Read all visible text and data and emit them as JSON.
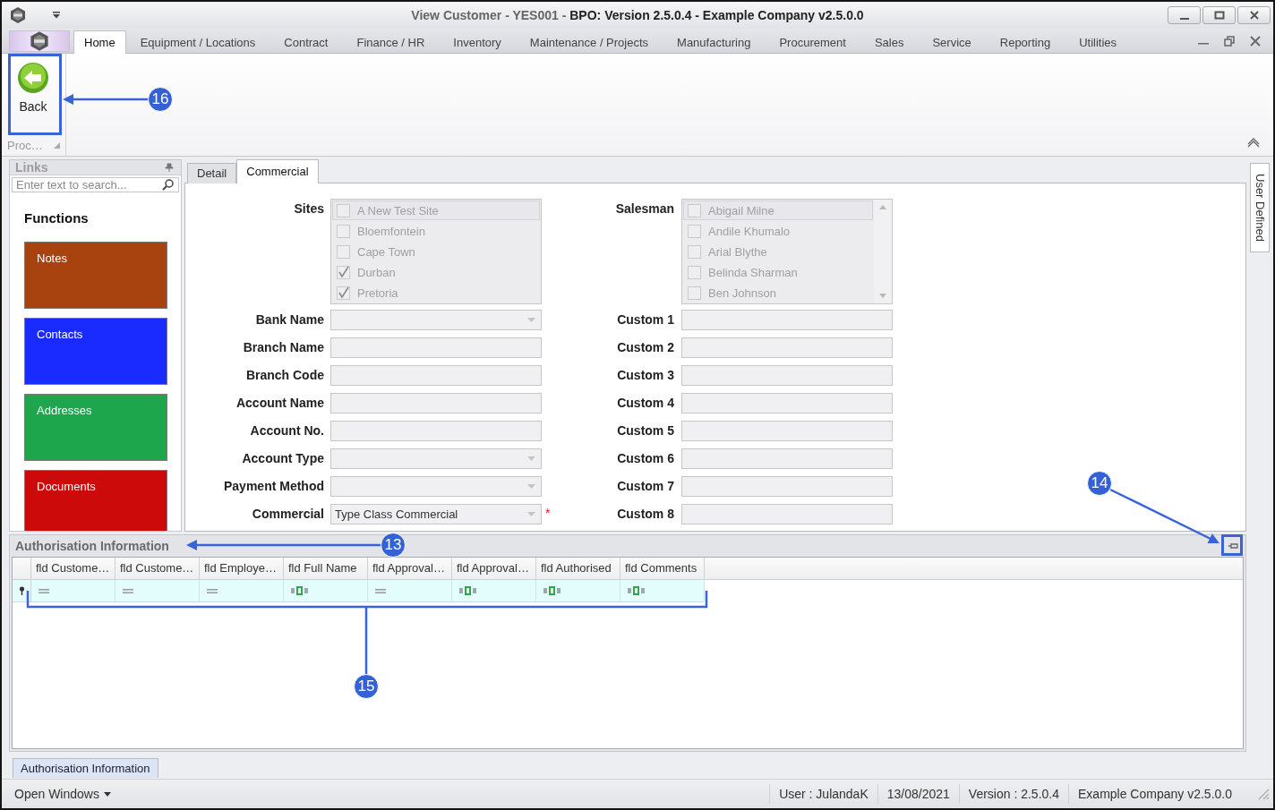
{
  "window": {
    "title": "View Customer - YES001 - **BPO: Version 2.5.0.4 - Example Company v2.5.0.0**"
  },
  "ribbon": {
    "tabs": [
      {
        "label": "Home",
        "selected": true
      },
      {
        "label": "Equipment / Locations",
        "selected": false
      },
      {
        "label": "Contract",
        "selected": false
      },
      {
        "label": "Finance / HR",
        "selected": false
      },
      {
        "label": "Inventory",
        "selected": false
      },
      {
        "label": "Maintenance / Projects",
        "selected": false
      },
      {
        "label": "Manufacturing",
        "selected": false
      },
      {
        "label": "Procurement",
        "selected": false
      },
      {
        "label": "Sales",
        "selected": false
      },
      {
        "label": "Service",
        "selected": false
      },
      {
        "label": "Reporting",
        "selected": false
      },
      {
        "label": "Utilities",
        "selected": false
      }
    ],
    "groups": [
      {
        "caption": "Proc…",
        "buttons": [
          {
            "label": "Back"
          }
        ]
      }
    ]
  },
  "links_panel": {
    "title": "Links",
    "search": {
      "placeholder": "Enter text to search..."
    },
    "heading": "Functions",
    "tiles": [
      {
        "label": "Notes",
        "color": "#a8420e"
      },
      {
        "label": "Contacts",
        "color": "#1a2bff"
      },
      {
        "label": "Addresses",
        "color": "#1ea64c"
      },
      {
        "label": "Documents",
        "color": "#cc0a0a"
      }
    ]
  },
  "form_tabs": [
    {
      "label": "Detail",
      "selected": false
    },
    {
      "label": "Commercial",
      "selected": true
    }
  ],
  "sites": {
    "label": "Sites",
    "items": [
      {
        "label": "A New Test Site",
        "checked": false,
        "selected": true
      },
      {
        "label": "Bloemfontein",
        "checked": false,
        "selected": false
      },
      {
        "label": "Cape Town",
        "checked": false,
        "selected": false
      },
      {
        "label": "Durban",
        "checked": true,
        "selected": false
      },
      {
        "label": "Pretoria",
        "checked": true,
        "selected": false
      }
    ]
  },
  "salesman": {
    "label": "Salesman",
    "items": [
      {
        "label": "Abigail Milne",
        "checked": false,
        "selected": true
      },
      {
        "label": "Andile Khumalo",
        "checked": false,
        "selected": false
      },
      {
        "label": "Arial Blythe",
        "checked": false,
        "selected": false
      },
      {
        "label": "Belinda Sharman",
        "checked": false,
        "selected": false
      },
      {
        "label": "Ben Johnson",
        "checked": false,
        "selected": false
      }
    ]
  },
  "fields_left": [
    {
      "label": "Bank Name",
      "kind": "dropdown"
    },
    {
      "label": "Branch Name",
      "kind": "text"
    },
    {
      "label": "Branch Code",
      "kind": "text"
    },
    {
      "label": "Account Name",
      "kind": "text"
    },
    {
      "label": "Account No.",
      "kind": "text"
    },
    {
      "label": "Account Type",
      "kind": "dropdown"
    },
    {
      "label": "Payment Method",
      "kind": "dropdown"
    },
    {
      "label": "Commercial",
      "kind": "dropdown",
      "value": "Type Class Commercial",
      "required_mark": "*"
    }
  ],
  "fields_right": [
    {
      "label": "Custom 1",
      "kind": "text"
    },
    {
      "label": "Custom 2",
      "kind": "text"
    },
    {
      "label": "Custom 3",
      "kind": "text"
    },
    {
      "label": "Custom 4",
      "kind": "text"
    },
    {
      "label": "Custom 5",
      "kind": "text"
    },
    {
      "label": "Custom 6",
      "kind": "text"
    },
    {
      "label": "Custom 7",
      "kind": "text"
    },
    {
      "label": "Custom 8",
      "kind": "text"
    }
  ],
  "auth_panel": {
    "title": "Authorisation Information",
    "columns": [
      "fld Custome…",
      "fld Custome…",
      "fld Employe…",
      "fld Full Name",
      "fld Approval…",
      "fld Approval…",
      "fld Authorised",
      "fld Comments"
    ],
    "filter_row": [
      {
        "kind": "equals"
      },
      {
        "kind": "equals"
      },
      {
        "kind": "equals"
      },
      {
        "kind": "text"
      },
      {
        "kind": "equals"
      },
      {
        "kind": "text"
      },
      {
        "kind": "text"
      },
      {
        "kind": "text"
      }
    ]
  },
  "side_tabs": [
    {
      "label": "User Defined"
    }
  ],
  "bottom_tabs": [
    {
      "label": "Authorisation Information",
      "selected": true
    }
  ],
  "status_bar": {
    "menu": "Open Windows",
    "items": [
      "User : JulandaK",
      "13/08/2021",
      "Version : 2.5.0.4",
      "Example Company v2.5.0.0"
    ]
  },
  "callouts": [
    {
      "number": "16"
    },
    {
      "number": "14"
    },
    {
      "number": "13"
    },
    {
      "number": "15"
    }
  ]
}
